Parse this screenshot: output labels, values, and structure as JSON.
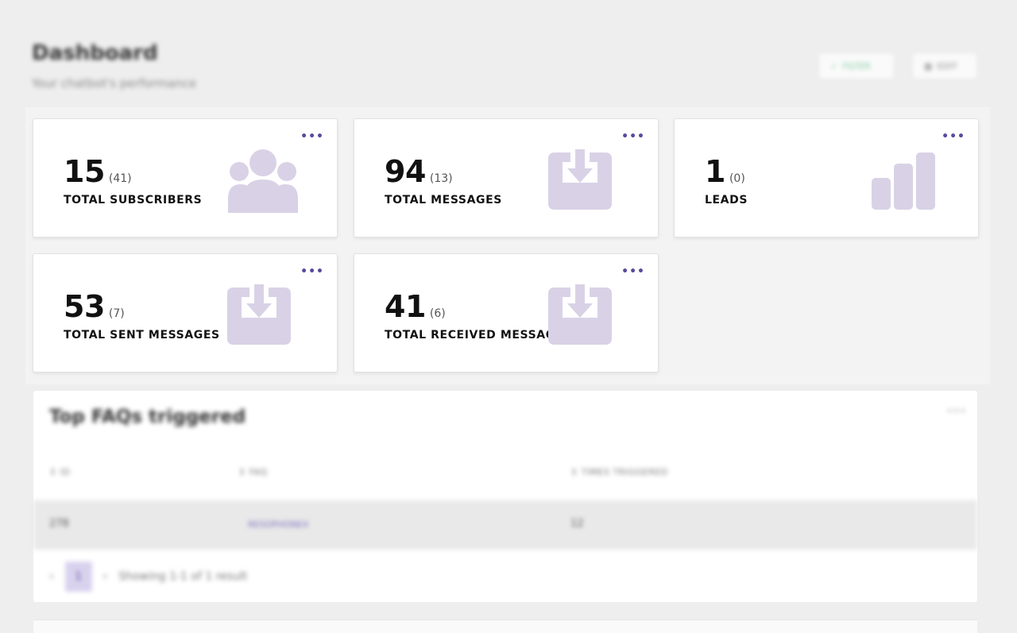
{
  "header": {
    "title": "Dashboard",
    "subtitle": "Your chatbot's performance",
    "filter_label": "FILTER",
    "edit_label": "EDIT"
  },
  "cards": [
    {
      "value": "15",
      "sub": "(41)",
      "label": "TOTAL SUBSCRIBERS",
      "icon": "users-icon"
    },
    {
      "value": "94",
      "sub": "(13)",
      "label": "TOTAL MESSAGES",
      "icon": "inbox-download-icon"
    },
    {
      "value": "1",
      "sub": "(0)",
      "label": "LEADS",
      "icon": "bar-chart-icon"
    },
    {
      "value": "53",
      "sub": "(7)",
      "label": "TOTAL SENT MESSAGES",
      "icon": "inbox-download-icon"
    },
    {
      "value": "41",
      "sub": "(6)",
      "label": "TOTAL RECEIVED MESSAGES",
      "icon": "inbox-download-icon"
    }
  ],
  "card_menu_label": "•••",
  "faq": {
    "title": "Top FAQs triggered",
    "menu_label": "•••",
    "columns": [
      "ID",
      "FAQ",
      "TIMES TRIGGERED"
    ],
    "rows": [
      {
        "id": "278",
        "faq": "RESOPHONEX",
        "times": "12"
      }
    ],
    "pager": {
      "prev": "‹",
      "page": "1",
      "next": "›",
      "summary": "Showing 1-1 of 1 result"
    }
  },
  "colors": {
    "icon_fill": "#d9d2e6",
    "accent": "#5a4a9c",
    "filter_accent": "#7ccb9e"
  }
}
